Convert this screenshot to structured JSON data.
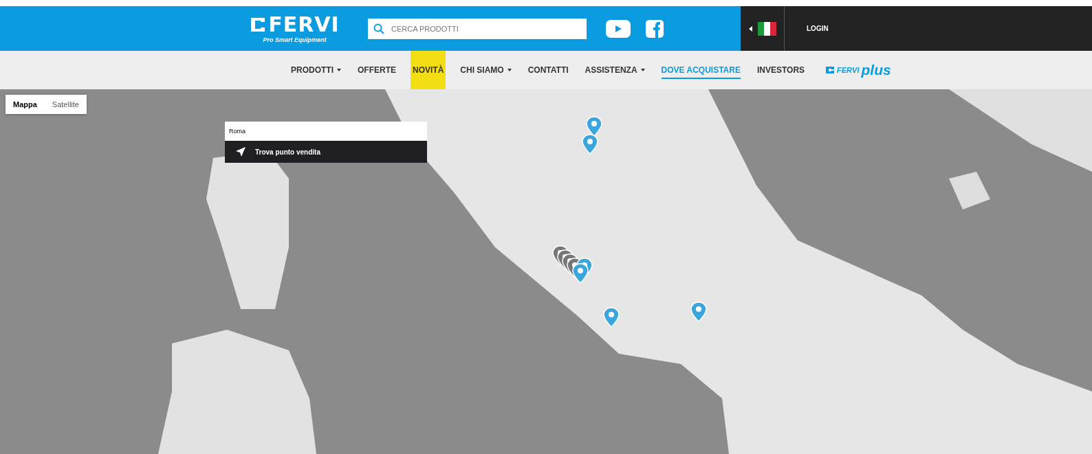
{
  "header": {
    "logo": {
      "name": "FERVI",
      "tagline": "Pro Smart Equipment"
    },
    "search": {
      "placeholder": "CERCA PRODOTTI"
    },
    "login": "LOGIN"
  },
  "nav": {
    "items": [
      {
        "label": "PRODOTTI",
        "has_menu": true,
        "highlighted": false,
        "selected": false
      },
      {
        "label": "OFFERTE",
        "has_menu": false,
        "highlighted": false,
        "selected": false
      },
      {
        "label": "NOVITÀ",
        "has_menu": false,
        "highlighted": true,
        "selected": false
      },
      {
        "label": "CHI SIAMO",
        "has_menu": true,
        "highlighted": false,
        "selected": false
      },
      {
        "label": "CONTATTI",
        "has_menu": false,
        "highlighted": false,
        "selected": false
      },
      {
        "label": "ASSISTENZA",
        "has_menu": true,
        "highlighted": false,
        "selected": false
      },
      {
        "label": "DOVE ACQUISTARE",
        "has_menu": false,
        "highlighted": false,
        "selected": true
      },
      {
        "label": "INVESTORS",
        "has_menu": false,
        "highlighted": false,
        "selected": false
      }
    ],
    "brand": {
      "name": "FERVI",
      "suffix": "plus"
    }
  },
  "map": {
    "type_toggle": [
      {
        "label": "Mappa",
        "selected": true
      },
      {
        "label": "Satellite",
        "selected": false
      }
    ],
    "search": {
      "value": "Roma"
    },
    "find_button": "Trova punto vendita"
  }
}
